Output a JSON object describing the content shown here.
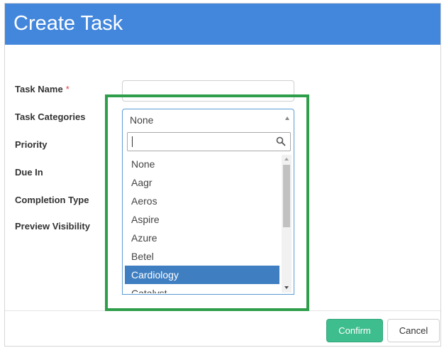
{
  "dialog": {
    "title": "Create Task"
  },
  "form": {
    "fields": [
      {
        "label": "Task Name",
        "required": true
      },
      {
        "label": "Task Categories"
      },
      {
        "label": "Priority"
      },
      {
        "label": "Due In"
      },
      {
        "label": "Completion Type"
      },
      {
        "label": "Preview Visibility"
      }
    ],
    "required_marker": "*"
  },
  "categories": {
    "selected_value": "None",
    "search_value": "",
    "options": [
      "None",
      "Aagr",
      "Aeros",
      "Aspire",
      "Azure",
      "Betel",
      "Cardiology",
      "Catalyst"
    ],
    "highlighted_option": "Cardiology"
  },
  "footer": {
    "confirm_label": "Confirm",
    "cancel_label": "Cancel"
  },
  "colors": {
    "header": "#4387dd",
    "confirm": "#3ebd8e",
    "highlight_frame": "#2f9e4a",
    "selected_option": "#3f7fc1"
  }
}
